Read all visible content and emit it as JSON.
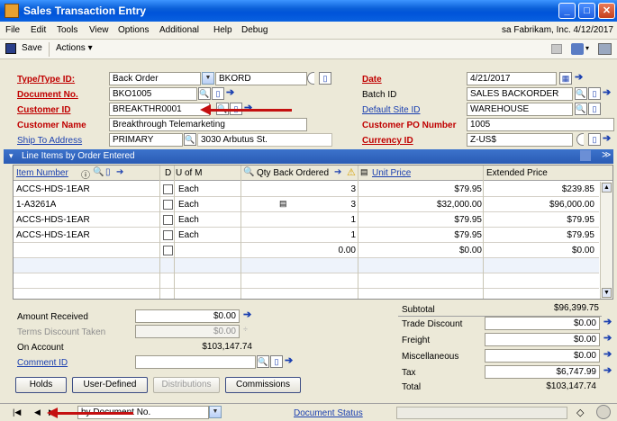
{
  "window": {
    "title": "Sales Transaction Entry"
  },
  "menu": {
    "items": [
      "File",
      "Edit",
      "Tools",
      "View",
      "Options",
      "Additional",
      "Help",
      "Debug"
    ],
    "right_text": "sa  Fabrikam, Inc.  4/12/2017"
  },
  "toolbar": {
    "save": "Save",
    "actions": "Actions ▾"
  },
  "header": {
    "type_label": "Type/Type ID:",
    "type_value": "Back Order",
    "type_id": "BKORD",
    "docno_label": "Document No.",
    "docno_value": "BKO1005",
    "customer_id_label": "Customer ID",
    "customer_id_value": "BREAKTHR0001",
    "customer_name_label": "Customer Name",
    "customer_name_value": "Breakthrough Telemarketing",
    "ship_label": "Ship To Address",
    "ship_code": "PRIMARY",
    "ship_address": "3030 Arbutus St.",
    "date_label": "Date",
    "date_value": "4/21/2017",
    "batch_label": "Batch ID",
    "batch_value": "SALES BACKORDER",
    "site_label": "Default Site ID",
    "site_value": "WAREHOUSE",
    "po_label": "Customer PO Number",
    "po_value": "1005",
    "currency_label": "Currency ID",
    "currency_value": "Z-US$"
  },
  "grid": {
    "bar_title": "Line Items by Order Entered",
    "col_item": "Item Number",
    "col_d": "D",
    "col_uom": "U of M",
    "col_qty": "Qty Back Ordered",
    "col_price": "Unit Price",
    "col_ext": "Extended Price",
    "rows": [
      {
        "item": "ACCS-HDS-1EAR",
        "uom": "Each",
        "qty": "3",
        "price": "$79.95",
        "ext": "$239.85"
      },
      {
        "item": "1-A3261A",
        "uom": "Each",
        "qty": "3",
        "price": "$32,000.00",
        "ext": "$96,000.00"
      },
      {
        "item": "ACCS-HDS-1EAR",
        "uom": "Each",
        "qty": "1",
        "price": "$79.95",
        "ext": "$79.95"
      },
      {
        "item": "ACCS-HDS-1EAR",
        "uom": "Each",
        "qty": "1",
        "price": "$79.95",
        "ext": "$79.95"
      },
      {
        "item": "",
        "uom": "",
        "qty": "0.00",
        "price": "$0.00",
        "ext": "$0.00"
      }
    ]
  },
  "totals": {
    "amount_received_label": "Amount Received",
    "amount_received": "$0.00",
    "terms_label": "Terms Discount Taken",
    "terms": "$0.00",
    "on_account_label": "On Account",
    "on_account": "$103,147.74",
    "comment_label": "Comment ID",
    "subtotal_label": "Subtotal",
    "subtotal": "$96,399.75",
    "trade_label": "Trade Discount",
    "trade": "$0.00",
    "freight_label": "Freight",
    "freight": "$0.00",
    "misc_label": "Miscellaneous",
    "misc": "$0.00",
    "tax_label": "Tax",
    "tax": "$6,747.99",
    "total_label": "Total",
    "total": "$103,147.74"
  },
  "buttons": {
    "holds": "Holds",
    "user_defined": "User-Defined",
    "distributions": "Distributions",
    "commissions": "Commissions"
  },
  "status": {
    "sort": "by Document No.",
    "doc_status": "Document Status"
  }
}
